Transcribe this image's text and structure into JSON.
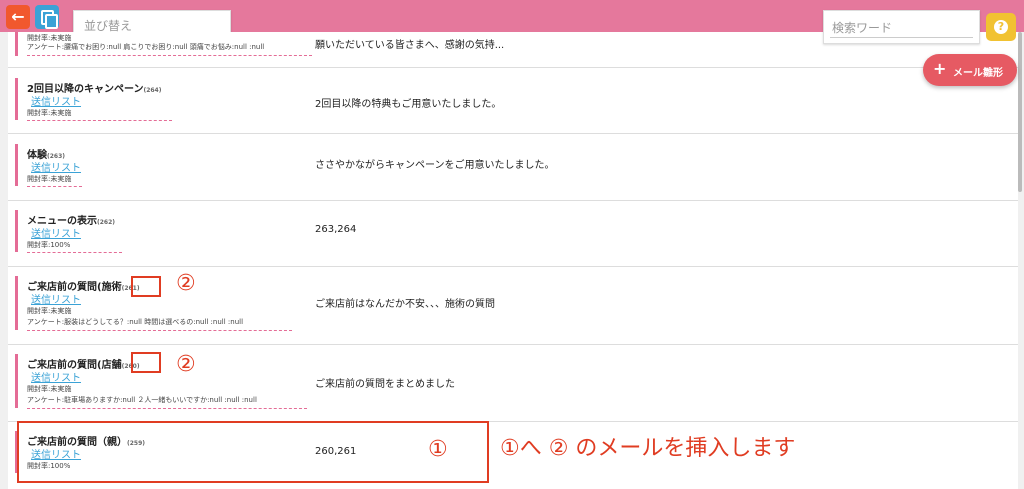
{
  "toolbar": {
    "back_icon": "←",
    "sort_placeholder": "並び替え",
    "search_placeholder": "検索ワード",
    "help_icon": "?",
    "add_template_label": "メール雛形",
    "add_icon": "+"
  },
  "rows": [
    {
      "title": "",
      "number": "",
      "link": "",
      "open_rate": "開封率:未実施",
      "survey": "アンケート:腰痛でお困り:null 肩こりでお困り:null 頭痛でお悩み:null :null",
      "description": "願いただいている皆さまへ、感謝の気持..."
    },
    {
      "title": "2回目以降のキャンペーン",
      "number": "(264)",
      "link": "送信リスト",
      "open_rate": "開封率:未実施",
      "survey": "",
      "description": "2回目以降の特典もご用意いたしました。"
    },
    {
      "title": "体験",
      "number": "(263)",
      "link": "送信リスト",
      "open_rate": "開封率:未実施",
      "survey": "",
      "description": "ささやかながらキャンペーンをご用意いたしました。"
    },
    {
      "title": "メニューの表示",
      "number": "(262)",
      "link": "送信リスト",
      "open_rate": "開封率:100%",
      "survey": "",
      "description": "263,264"
    },
    {
      "title": "ご来店前の質問(施術",
      "number": "(261)",
      "link": "送信リスト",
      "open_rate": "開封率:未実施",
      "survey": "アンケート:服装はどうしてる？:null 時間は選べるの:null :null :null",
      "description": "ご来店前はなんだか不安、、、施術の質問"
    },
    {
      "title": "ご来店前の質問(店舗",
      "number": "(260)",
      "link": "送信リスト",
      "open_rate": "開封率:未実施",
      "survey": "アンケート:駐車場ありますか:null ２人一緒もいいですか:null :null :null",
      "description": "ご来店前の質問をまとめました"
    },
    {
      "title": "ご来店前の質問（親）",
      "number": "(259)",
      "link": "送信リスト",
      "open_rate": "開封率:100%",
      "survey": "",
      "description": "260,261"
    }
  ],
  "annotations": {
    "num1": "①",
    "num2": "②",
    "instruction": "①へ ② のメールを挿入します"
  },
  "colors": {
    "header": "#e5789c",
    "accent_bar": "#e46c96",
    "annotation": "#e03c22",
    "link": "#3aa2d6",
    "fab": "#e65a63"
  }
}
